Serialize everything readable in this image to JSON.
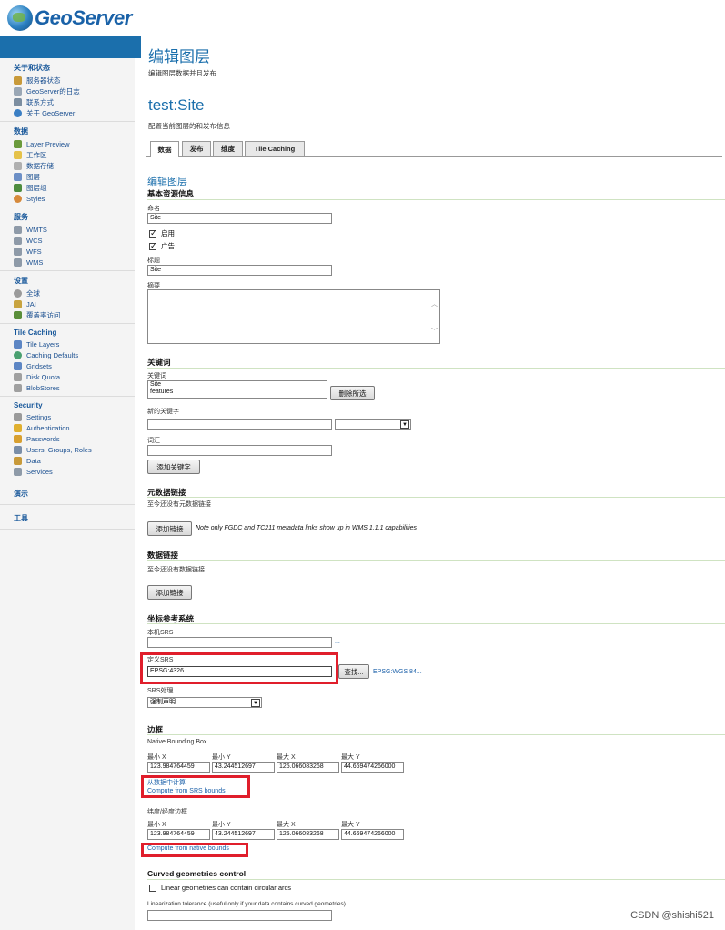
{
  "header": {
    "logo_text": "GeoServer"
  },
  "sidebar": {
    "sections": [
      {
        "title": "关于和状态",
        "items": [
          "服务器状态",
          "GeoServer的日志",
          "联系方式",
          "关于 GeoServer"
        ]
      },
      {
        "title": "数据",
        "items": [
          "Layer Preview",
          "工作区",
          "数据存储",
          "图层",
          "图层组",
          "Styles"
        ]
      },
      {
        "title": "服务",
        "items": [
          "WMTS",
          "WCS",
          "WFS",
          "WMS"
        ]
      },
      {
        "title": "设置",
        "items": [
          "全球",
          "JAI",
          "覆盖率访问"
        ]
      },
      {
        "title": "Tile Caching",
        "items": [
          "Tile Layers",
          "Caching Defaults",
          "Gridsets",
          "Disk Quota",
          "BlobStores"
        ]
      },
      {
        "title": "Security",
        "items": [
          "Settings",
          "Authentication",
          "Passwords",
          "Users, Groups, Roles",
          "Data",
          "Services"
        ]
      },
      {
        "title": "演示",
        "items": []
      },
      {
        "title": "工具",
        "items": []
      }
    ]
  },
  "page": {
    "title": "编辑图层",
    "subtitle": "编辑图层数据并且发布",
    "layer_title": "test:Site",
    "layer_subtitle": "配置当前图层的和发布信息"
  },
  "tabs": [
    "数据",
    "发布",
    "维度",
    "Tile Caching"
  ],
  "form": {
    "section_title": "编辑图层",
    "basic_info": "基本资源信息",
    "name_label": "命名",
    "name_value": "Site",
    "enabled_label": "启用",
    "advertised_label": "广告",
    "title_label": "标题",
    "title_value": "Site",
    "abstract_label": "摘要",
    "keywords_header": "关键词",
    "keywords_label": "关键词",
    "keywords_values": [
      "Site",
      "features"
    ],
    "remove_selected": "删除所选",
    "new_keyword_label": "新的关键字",
    "vocabulary_label": "词汇",
    "add_keyword": "添加关键字",
    "metadata_header": "元数据链接",
    "metadata_empty": "至今还没有元数据链接",
    "add_link": "添加链接",
    "metadata_note": "Note only FGDC and TC211 metadata links show up in WMS 1.1.1 capabilities",
    "data_links_header": "数据链接",
    "data_links_empty": "至今还没有数据链接",
    "add_link2": "添加链接",
    "crs_header": "坐标参考系统",
    "native_srs_label": "本机SRS",
    "native_srs_ellipsis": "...",
    "declared_srs_label": "定义SRS",
    "declared_srs_value": "EPSG:4326",
    "find_button": "查找...",
    "wgs_link": "EPSG:WGS 84...",
    "srs_handling_label": "SRS处理",
    "srs_handling_value": "强制声明",
    "bbox_header": "边框",
    "native_bbox_label": "Native Bounding Box",
    "minx": "最小 X",
    "miny": "最小 Y",
    "maxx": "最大 X",
    "maxy": "最大 Y",
    "native_values": [
      "123.984764459",
      "43.244512697",
      "125.066083268",
      "44.669474266000"
    ],
    "compute_from_data": "从数据中计算",
    "compute_from_srs": "Compute from SRS bounds",
    "latlon_bbox_label": "纬度/经度边框",
    "latlon_values": [
      "123.984764459",
      "43.244512697",
      "125.066083268",
      "44.669474266000"
    ],
    "compute_from_native": "Compute from native bounds",
    "curved_header": "Curved geometries control",
    "curved_check": "Linear geometries can contain circular arcs",
    "linearization_label": "Linearization tolerance (useful only if your data contains curved geometries)"
  },
  "watermark": "CSDN @shishi521"
}
